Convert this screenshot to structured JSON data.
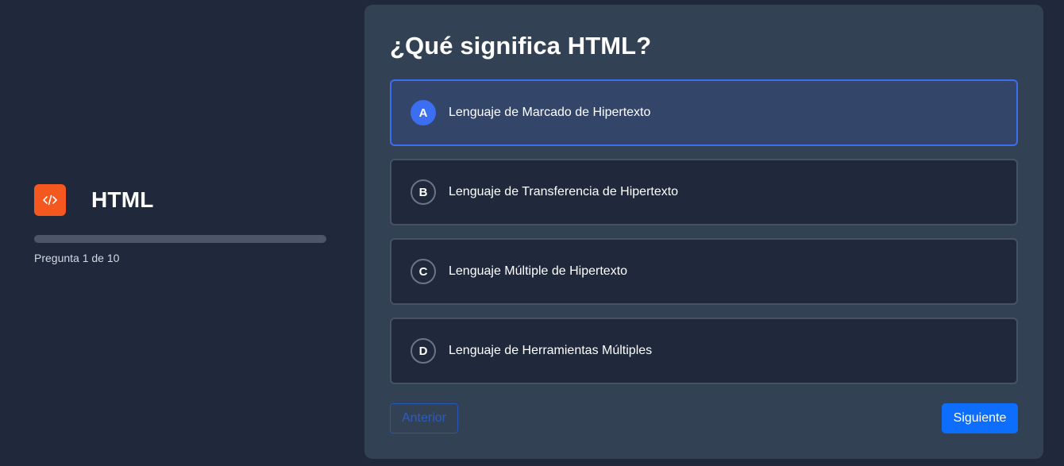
{
  "sidebar": {
    "topic_icon": "code-icon",
    "topic_icon_color": "#f4581e",
    "topic_title": "HTML",
    "progress": {
      "current": 1,
      "total": 10,
      "fraction": 0.0,
      "label": "Pregunta 1 de 10"
    }
  },
  "quiz": {
    "question": "¿Qué significa HTML?",
    "selected": "A",
    "options": [
      {
        "letter": "A",
        "text": "Lenguaje de Marcado de Hipertexto"
      },
      {
        "letter": "B",
        "text": "Lenguaje de Transferencia de Hipertexto"
      },
      {
        "letter": "C",
        "text": "Lenguaje Múltiple de Hipertexto"
      },
      {
        "letter": "D",
        "text": "Lenguaje de Herramientas Múltiples"
      }
    ],
    "prev_label": "Anterior",
    "next_label": "Siguiente"
  },
  "colors": {
    "background": "#1f293b",
    "card": "#334155",
    "accent": "#3b6ef1",
    "primary_button": "#0d6efd"
  }
}
